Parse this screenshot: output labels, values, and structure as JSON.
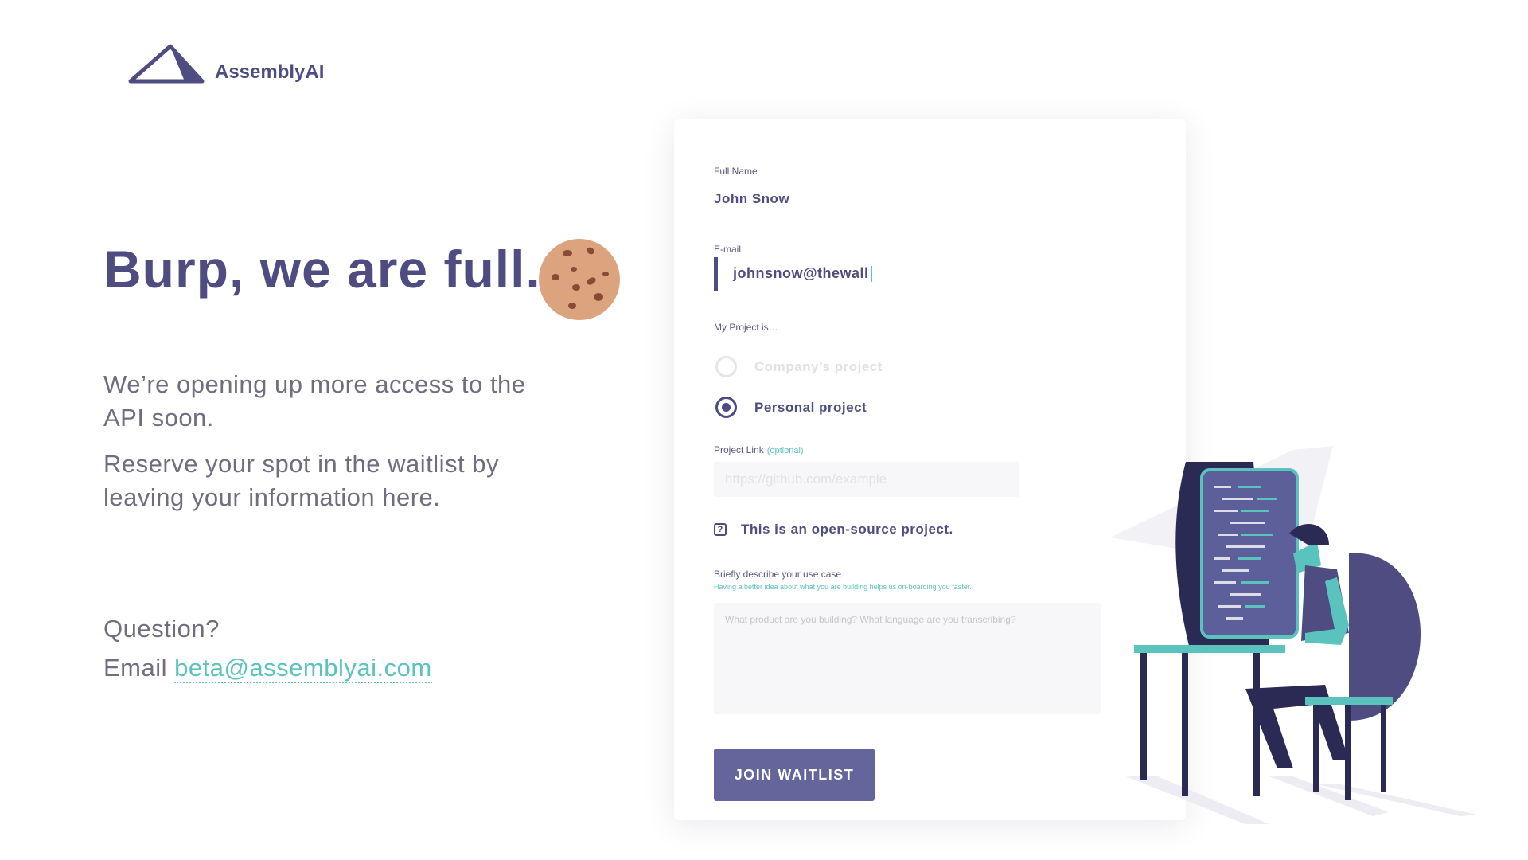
{
  "brand": {
    "name": "AssemblyAI",
    "logo_icon": "triangle-logo-icon"
  },
  "hero": {
    "headline": "Burp, we are full.",
    "cookie_icon": "cookie-icon",
    "paragraph1": "We’re opening up more access to the API soon.",
    "paragraph2": "Reserve your spot in the waitlist by leaving your information here.",
    "question_label": "Question?",
    "email_prefix": "Email",
    "email_link": "beta@assemblyai.com"
  },
  "form": {
    "full_name": {
      "label": "Full Name",
      "value": "John Snow"
    },
    "email": {
      "label": "E-mail",
      "value": "johnsnow@thewall"
    },
    "project": {
      "label": "My Project is…",
      "options": [
        {
          "label": "Company’s project",
          "selected": false
        },
        {
          "label": "Personal project",
          "selected": true
        }
      ]
    },
    "project_link": {
      "label": "Project Link",
      "optional": "(optional)",
      "placeholder": "https://github.com/example"
    },
    "open_source": {
      "label": "This is an open-source project.",
      "check_mark": "?"
    },
    "use_case": {
      "label": "Briefly describe your use case",
      "hint": "Having a better idea about what you are building helps us on-boarding you faster.",
      "placeholder": "What product are you building? What language are you transcribing?"
    },
    "submit_label": "JOIN WAITLIST"
  },
  "colors": {
    "primary": "#4f4c82",
    "accent": "#5bc3bd",
    "button": "#64659a",
    "body_text": "#6f6e80"
  },
  "illustration_icon": "developer-at-computer-illustration"
}
